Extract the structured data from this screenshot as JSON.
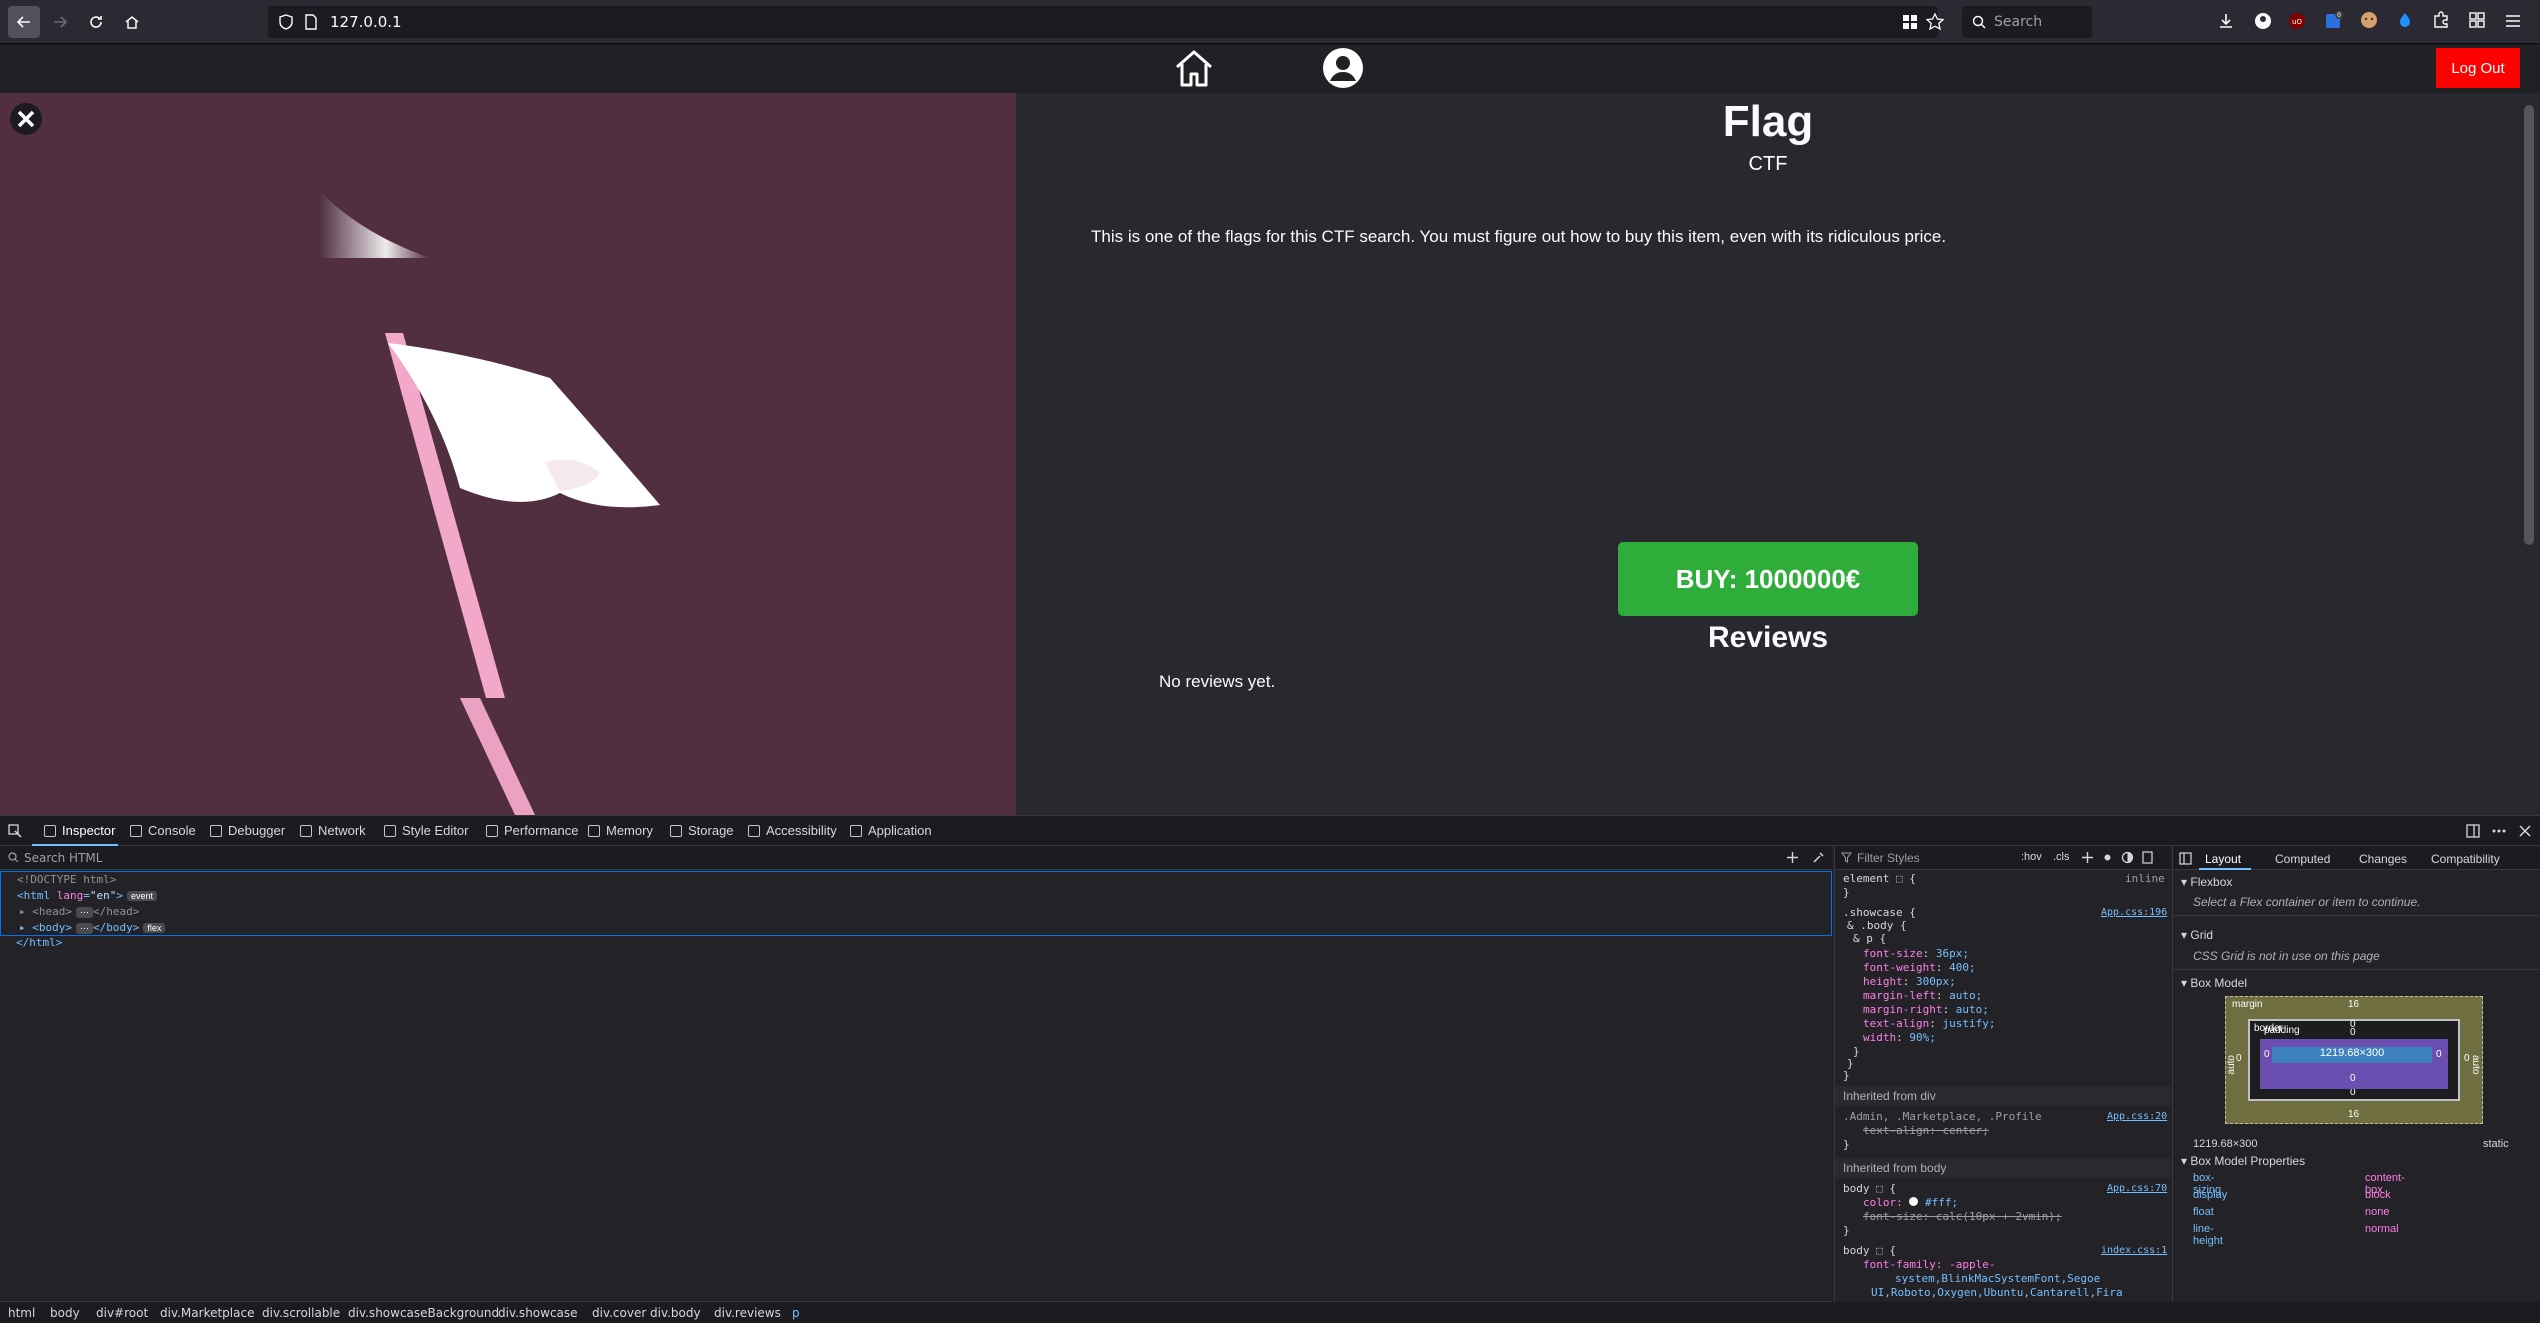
{
  "browser": {
    "url": "127.0.0.1",
    "search_placeholder": "Search"
  },
  "app": {
    "logout_label": "Log Out"
  },
  "product": {
    "title": "Flag",
    "category": "CTF",
    "description": "This is one of the flags for this CTF search. You must figure out how to buy this item, even with its ridiculous price.",
    "buy_label": "BUY: 1000000€",
    "reviews_heading": "Reviews",
    "no_reviews": "No reviews yet."
  },
  "devtools": {
    "tabs": [
      "Inspector",
      "Console",
      "Debugger",
      "Network",
      "Style Editor",
      "Performance",
      "Memory",
      "Storage",
      "Accessibility",
      "Application"
    ],
    "search_html_placeholder": "Search HTML",
    "filter_styles_placeholder": "Filter Styles",
    "hov": ":hov",
    "cls": ".cls",
    "html_tree": {
      "doctype": "<!DOCTYPE html>",
      "html_open_tag": "html",
      "lang_attr": "lang",
      "lang_val": "\"en\"",
      "event_badge": "event",
      "head": "head",
      "body": "body",
      "flex_badge": "flex",
      "html_close": "</html>"
    },
    "breadcrumbs": [
      "html",
      "body",
      "div#root",
      "div.Marketplace",
      "div.scrollable",
      "div.showcaseBackground",
      "div.showcase",
      "div.cover",
      "div.body",
      "div.reviews",
      "p"
    ],
    "rules": {
      "element_label": "element",
      "inline": "inline",
      "showcase_selector": ".showcase {",
      "showcase_nested1": "& .body {",
      "showcase_nested2": "& p {",
      "app_css_196": "App.css:196",
      "props": [
        {
          "k": "font-size",
          "v": "36px;"
        },
        {
          "k": "font-weight",
          "v": "400;"
        },
        {
          "k": "height",
          "v": "300px;"
        },
        {
          "k": "margin-left",
          "v": "auto;"
        },
        {
          "k": "margin-right",
          "v": "auto;"
        },
        {
          "k": "text-align",
          "v": "justify;"
        },
        {
          "k": "width",
          "v": "90%;"
        }
      ],
      "inherited_div": "Inherited from div",
      "admin_selector": ".Admin, .Marketplace, .Profile",
      "app_css_20": "App.css:20",
      "text_align_center": "text-align: center;",
      "inherited_body": "Inherited from body",
      "body_selector": "body",
      "app_css_70": "App.css:70",
      "color_prop": "color:",
      "color_val": "#fff;",
      "font_size_calc": "font-size: calc(10px + 2vmin);",
      "index_css_1": "index.css:1",
      "font_family_prop": "font-family: -apple-",
      "font_family_val1": "system,BlinkMacSystemFont,Segoe",
      "font_family_val2": "UI,Roboto,Oxygen,Ubuntu,Cantarell,Fira"
    },
    "layout": {
      "tabs": [
        "Layout",
        "Computed",
        "Changes",
        "Compatibility"
      ],
      "flexbox": "Flexbox",
      "flexbox_note": "Select a Flex container or item to continue.",
      "grid": "Grid",
      "grid_note": "CSS Grid is not in use on this page",
      "box_model": "Box Model",
      "margin_label": "margin",
      "border_label": "border",
      "padding_label": "padding",
      "content_size": "1219.68×300",
      "margin_top": "16",
      "margin_bottom": "16",
      "margin_side": "auto",
      "zero": "0",
      "dimensions": "1219.68×300",
      "position": "static",
      "props_heading": "Box Model Properties",
      "props": [
        {
          "k": "box-sizing",
          "v": "content-box"
        },
        {
          "k": "display",
          "v": "block"
        },
        {
          "k": "float",
          "v": "none"
        },
        {
          "k": "line-height",
          "v": "normal"
        }
      ]
    }
  }
}
